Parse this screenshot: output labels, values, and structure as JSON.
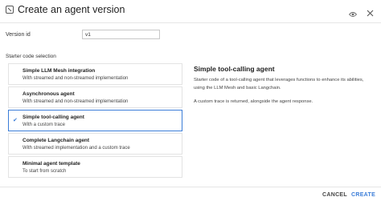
{
  "dialog": {
    "title": "Create an agent version",
    "icons": {
      "header": "agent-icon",
      "view": "eye-icon",
      "close": "close-icon"
    }
  },
  "form": {
    "version_label": "Version id",
    "version_value": "v1",
    "starter_label": "Starter code selection"
  },
  "options": [
    {
      "title": "Simple LLM Mesh integration",
      "desc": "With streamed and non-streamed implementation"
    },
    {
      "title": "Asynchronous agent",
      "desc": "With streamed and non-streamed implementation"
    },
    {
      "title": "Simple tool-calling agent",
      "desc": "With a custom trace"
    },
    {
      "title": "Complete Langchain agent",
      "desc": "With streamed implementation and a custom trace"
    },
    {
      "title": "Minimal agent template",
      "desc": "To start from scratch"
    }
  ],
  "selected_index": 2,
  "details": {
    "title": "Simple tool-calling agent",
    "body": "Starter code of a tool-calling agent that leverages functions to enhance its abilities, using the LLM Mesh and basic Langchain.",
    "note": "A custom trace is returned, alongside the agent response."
  },
  "footer": {
    "cancel": "CANCEL",
    "create": "CREATE"
  },
  "colors": {
    "accent": "#3b7dd8",
    "border": "#e3e3e3"
  }
}
